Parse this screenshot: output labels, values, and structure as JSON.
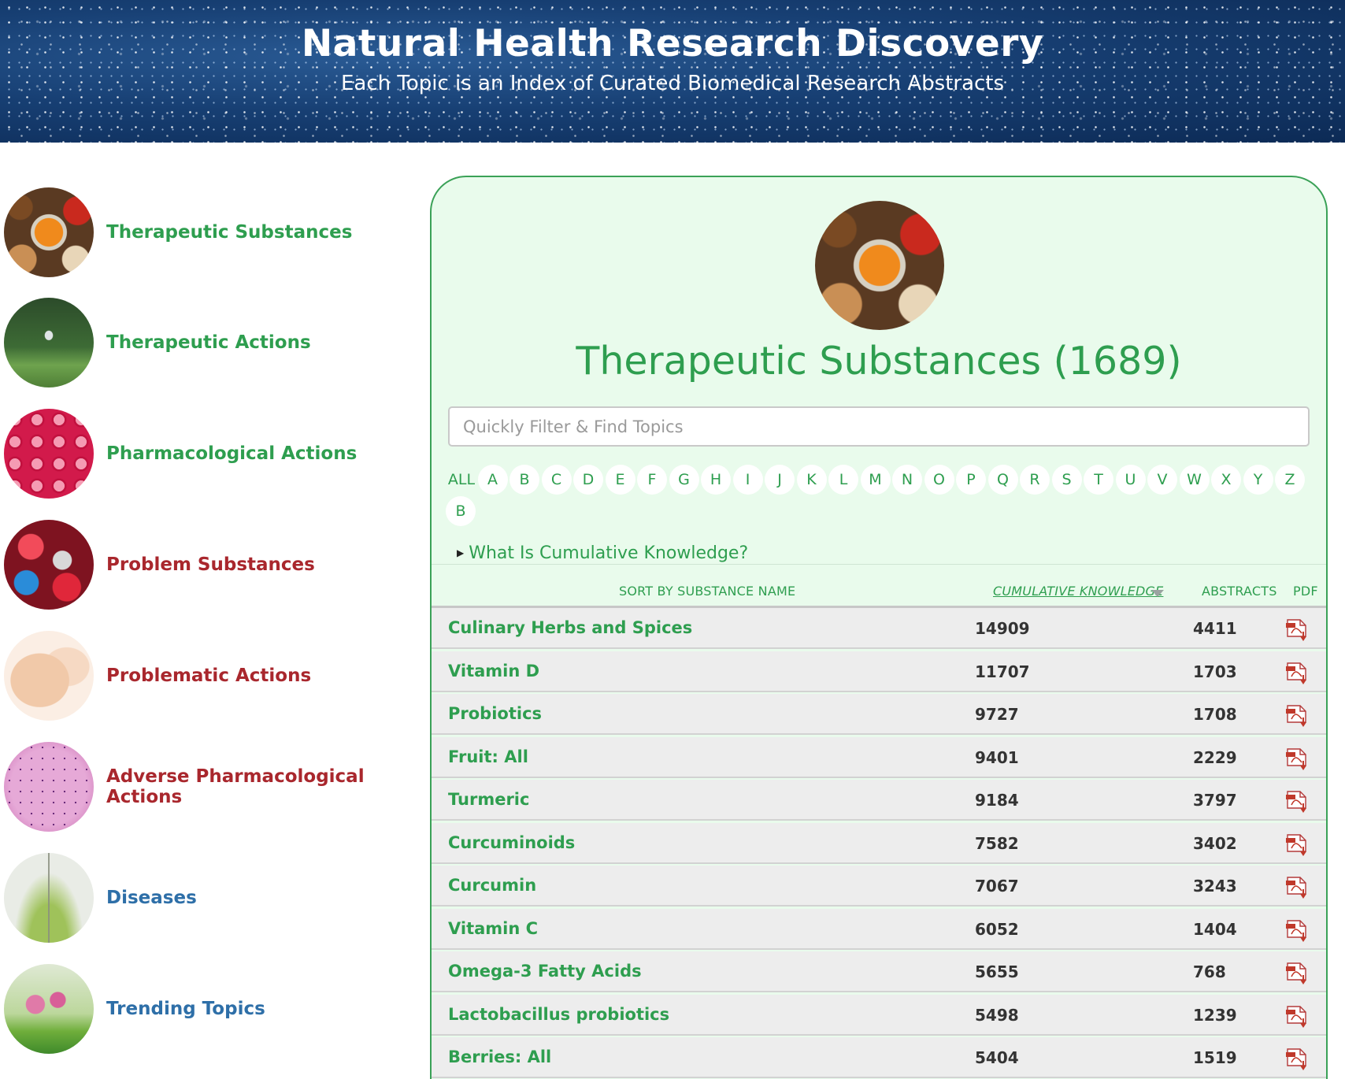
{
  "header": {
    "title": "Natural Health Research Discovery",
    "subtitle": "Each Topic is an Index of Curated Biomedical Research Abstracts"
  },
  "sidebar": {
    "items": [
      {
        "label": "Therapeutic Substances",
        "color": "#2e9e4f",
        "thumb": "spices-image"
      },
      {
        "label": "Therapeutic Actions",
        "color": "#2e9e4f",
        "thumb": "yoga-image"
      },
      {
        "label": "Pharmacological Actions",
        "color": "#2e9e4f",
        "thumb": "cells-image"
      },
      {
        "label": "Problem Substances",
        "color": "#a9272d",
        "thumb": "pills-image"
      },
      {
        "label": "Problematic Actions",
        "color": "#a9272d",
        "thumb": "baby-injection-image"
      },
      {
        "label": "Adverse Pharmacological Actions",
        "color": "#a9272d",
        "thumb": "tissue-image"
      },
      {
        "label": "Diseases",
        "color": "#2e6fa8",
        "thumb": "leaf-image"
      },
      {
        "label": "Trending Topics",
        "color": "#2e6fa8",
        "thumb": "clover-image"
      }
    ]
  },
  "main": {
    "title": "Therapeutic Substances (1689)",
    "filter_placeholder": "Quickly Filter & Find Topics",
    "letters": [
      "ALL",
      "A",
      "B",
      "C",
      "D",
      "E",
      "F",
      "G",
      "H",
      "I",
      "J",
      "K",
      "L",
      "M",
      "N",
      "O",
      "P",
      "Q",
      "R",
      "S",
      "T",
      "U",
      "V",
      "W",
      "X",
      "Y",
      "Z",
      "B"
    ],
    "whatis_label": "What Is Cumulative Knowledge?",
    "columns": {
      "name": "SORT BY SUBSTANCE NAME",
      "ck": "CUMULATIVE KNOWLEDGE",
      "abstracts": "ABSTRACTS",
      "pdf": "PDF"
    },
    "rows": [
      {
        "name": "Culinary Herbs and Spices",
        "ck": "14909",
        "abstracts": "4411"
      },
      {
        "name": "Vitamin D",
        "ck": "11707",
        "abstracts": "1703"
      },
      {
        "name": "Probiotics",
        "ck": "9727",
        "abstracts": "1708"
      },
      {
        "name": "Fruit: All",
        "ck": "9401",
        "abstracts": "2229"
      },
      {
        "name": "Turmeric",
        "ck": "9184",
        "abstracts": "3797"
      },
      {
        "name": "Curcuminoids",
        "ck": "7582",
        "abstracts": "3402"
      },
      {
        "name": "Curcumin",
        "ck": "7067",
        "abstracts": "3243"
      },
      {
        "name": "Vitamin C",
        "ck": "6052",
        "abstracts": "1404"
      },
      {
        "name": "Omega-3 Fatty Acids",
        "ck": "5655",
        "abstracts": "768"
      },
      {
        "name": "Lactobacillus probiotics",
        "ck": "5498",
        "abstracts": "1239"
      },
      {
        "name": "Berries: All",
        "ck": "5404",
        "abstracts": "1519"
      }
    ]
  },
  "colors": {
    "accent_green": "#2e9e4f",
    "problem_red": "#a9272d",
    "disease_blue": "#2e6fa8",
    "panel_bg": "#e9fbec"
  }
}
